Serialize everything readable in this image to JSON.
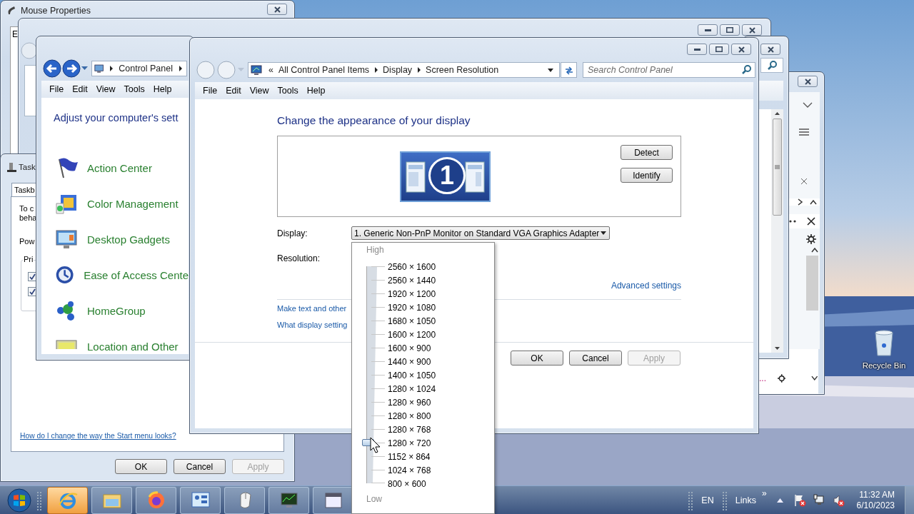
{
  "mouse_properties": {
    "title": "Mouse Properties",
    "fragment": "E"
  },
  "taskbar_properties": {
    "title": "Task",
    "tab": {
      "label": "Taskb",
      "selected": true
    },
    "lines": [
      "To c",
      "beha"
    ],
    "power_label": "Pow",
    "group_label": "Pri",
    "checkboxes": [
      {
        "checked": true
      },
      {
        "checked": true
      }
    ],
    "link": "How do I change the way the Start menu looks?",
    "buttons": [
      {
        "label": "OK",
        "disabled": false
      },
      {
        "label": "Cancel",
        "disabled": false
      },
      {
        "label": "Apply",
        "disabled": true
      }
    ]
  },
  "control_panel": {
    "address": [
      "Control Panel"
    ],
    "menu": [
      "File",
      "Edit",
      "View",
      "Tools",
      "Help"
    ],
    "heading": "Adjust your computer's sett",
    "items": [
      {
        "kind": "flag",
        "label": "Action Center"
      },
      {
        "kind": "color",
        "label": "Color Management"
      },
      {
        "kind": "gadgets",
        "label": "Desktop Gadgets"
      },
      {
        "kind": "access",
        "label": "Ease of Access Cente"
      },
      {
        "kind": "group",
        "label": "HomeGroup"
      },
      {
        "kind": "location",
        "label": "Location and Other"
      }
    ]
  },
  "screen_resolution": {
    "address_prefix": "«",
    "address": [
      "All Control Panel Items",
      "Display",
      "Screen Resolution"
    ],
    "search": {
      "placeholder": "Search Control Panel"
    },
    "menu": [
      "File",
      "Edit",
      "View",
      "Tools",
      "Help"
    ],
    "heading": "Change the appearance of your display",
    "monitor": {
      "number": "1"
    },
    "monitor_buttons": [
      "Detect",
      "Identify"
    ],
    "display_label": "Display:",
    "display_value": "1. Generic Non-PnP Monitor on Standard VGA Graphics Adapter",
    "resolution_label": "Resolution:",
    "advanced_link": "Advanced settings",
    "links": [
      "Make text and other",
      "What display setting"
    ],
    "buttons": [
      {
        "label": "OK",
        "disabled": false
      },
      {
        "label": "Cancel",
        "disabled": false
      },
      {
        "label": "Apply",
        "disabled": true
      }
    ]
  },
  "side_window": {
    "trailing_text": "..."
  },
  "resolution_popup": {
    "high_label": "High",
    "low_label": "Low",
    "level": 0.1875,
    "options": [
      {
        "label": "2560 × 1600"
      },
      {
        "label": "2560 × 1440"
      },
      {
        "label": "1920 × 1200"
      },
      {
        "label": "1920 × 1080"
      },
      {
        "label": "1680 × 1050"
      },
      {
        "label": "1600 × 1200"
      },
      {
        "label": "1600 × 900"
      },
      {
        "label": "1440 × 900"
      },
      {
        "label": "1400 × 1050"
      },
      {
        "label": "1280 × 1024"
      },
      {
        "label": "1280 × 960"
      },
      {
        "label": "1280 × 800"
      },
      {
        "label": "1280 × 768"
      },
      {
        "label": "1280 × 720"
      },
      {
        "label": "1152 × 864"
      },
      {
        "label": "1024 × 768"
      },
      {
        "label": "800 × 600"
      }
    ]
  },
  "desktop": {
    "recycle_bin": "Recycle Bin"
  },
  "taskbar": {
    "apps": [
      {
        "kind": "ie",
        "active": true
      },
      {
        "kind": "folder",
        "active": false
      },
      {
        "kind": "firefox",
        "active": false
      },
      {
        "kind": "control",
        "active": false
      },
      {
        "kind": "mouse",
        "active": false
      },
      {
        "kind": "monitor",
        "active": false
      },
      {
        "kind": "window",
        "active": false
      }
    ],
    "language": "EN",
    "toolbar": "Links",
    "toolbar_chevron": "»",
    "time": "11:32 AM",
    "date": "6/10/2023"
  }
}
